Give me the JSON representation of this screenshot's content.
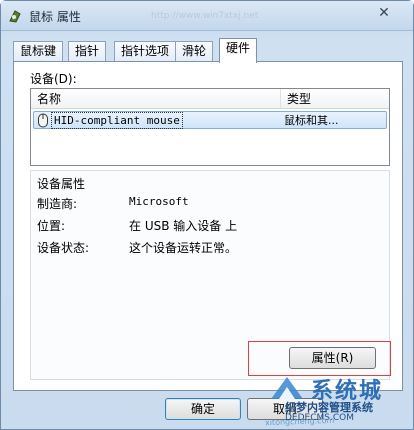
{
  "window": {
    "title": "鼠标 属性",
    "url_watermark": "http://www.win7xtxj.net"
  },
  "tabs": [
    {
      "label": "鼠标键"
    },
    {
      "label": "指针"
    },
    {
      "label": "指针选项"
    },
    {
      "label": "滑轮"
    },
    {
      "label": "硬件"
    }
  ],
  "devices": {
    "label": "设备(D):",
    "columns": {
      "name": "名称",
      "type": "类型"
    },
    "rows": [
      {
        "name": "HID-compliant mouse",
        "type": "鼠标和其..."
      }
    ]
  },
  "properties": {
    "title": "设备属性",
    "manufacturer_label": "制造商:",
    "manufacturer_value": "Microsoft",
    "location_label": "位置:",
    "location_value": "在 USB 输入设备 上",
    "status_label": "设备状态:",
    "status_value": "这个设备运转正常。",
    "button": "属性(R)"
  },
  "footer": {
    "ok": "确定",
    "cancel": "取消"
  },
  "watermark": {
    "logo_text": "系统城",
    "brand": "织梦内容管理系统",
    "domain": "DEDECMS.COM",
    "site": "xitongcheng.com"
  },
  "colors": {
    "accent": "#2f6fb5",
    "selection": "#cfe4fa",
    "highlight_frame": "#e04040"
  }
}
